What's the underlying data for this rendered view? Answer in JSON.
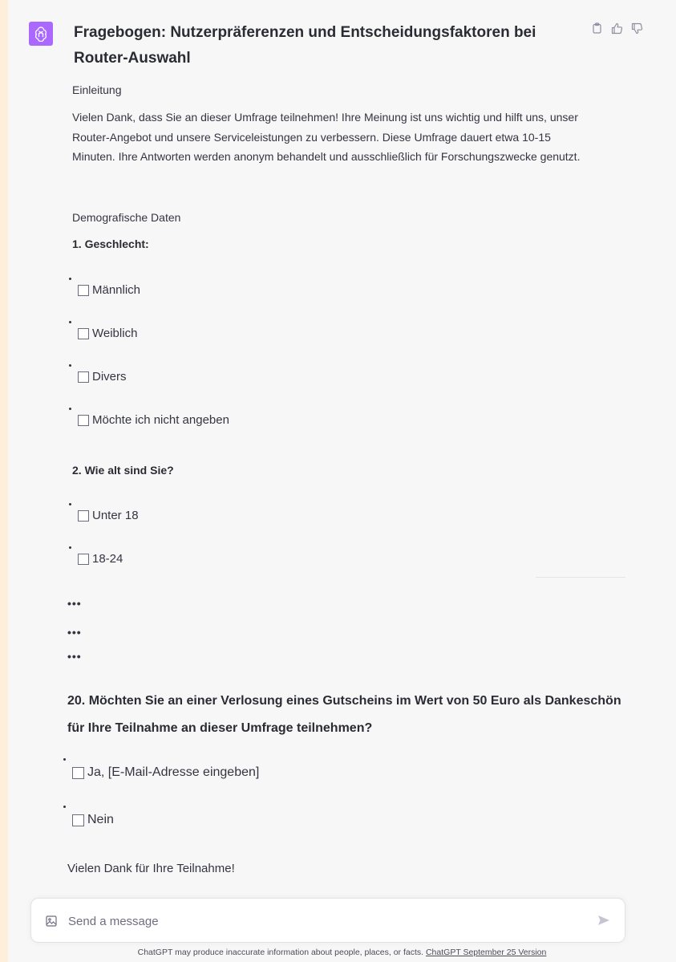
{
  "message": {
    "title": "Fragebogen: Nutzerpräferenzen und Entscheidungsfaktoren bei Router-Auswahl",
    "intro_heading": "Einleitung",
    "intro_text": "Vielen Dank, dass Sie an dieser Umfrage teilnehmen! Ihre Meinung ist uns wichtig und hilft uns, unser Router-Angebot und unsere Serviceleistungen zu verbessern. Diese Umfrage dauert etwa 10-15 Minuten. Ihre Antworten werden anonym behandelt und ausschließlich für Forschungszwecke genutzt.",
    "demo_heading": "Demografische Daten",
    "q1": {
      "label": "1. Geschlecht:",
      "options": [
        "Männlich",
        "Weiblich",
        "Divers",
        "Möchte ich nicht angeben"
      ]
    },
    "q2": {
      "label": "2. Wie alt sind Sie?",
      "options": [
        "Unter 18",
        "18-24"
      ]
    },
    "ellipses": [
      "•••",
      "•••",
      "•••"
    ],
    "q20": {
      "label": "20. Möchten Sie an einer Verlosung eines Gutscheins im Wert von 50 Euro als Dankeschön für Ihre Teilnahme an dieser Umfrage teilnehmen?",
      "options": [
        "Ja, [E-Mail-Adresse eingeben]",
        "Nein"
      ]
    },
    "closing": "Vielen Dank für Ihre Teilnahme!"
  },
  "composer": {
    "placeholder": "Send a message"
  },
  "footer": {
    "text": "ChatGPT may produce inaccurate information about people, places, or facts. ",
    "link": "ChatGPT September 25 Version"
  },
  "colors": {
    "page_background": "#fdefd9",
    "chat_background": "#f7f7f8",
    "avatar": "#ab68ff",
    "text": "#343541"
  }
}
